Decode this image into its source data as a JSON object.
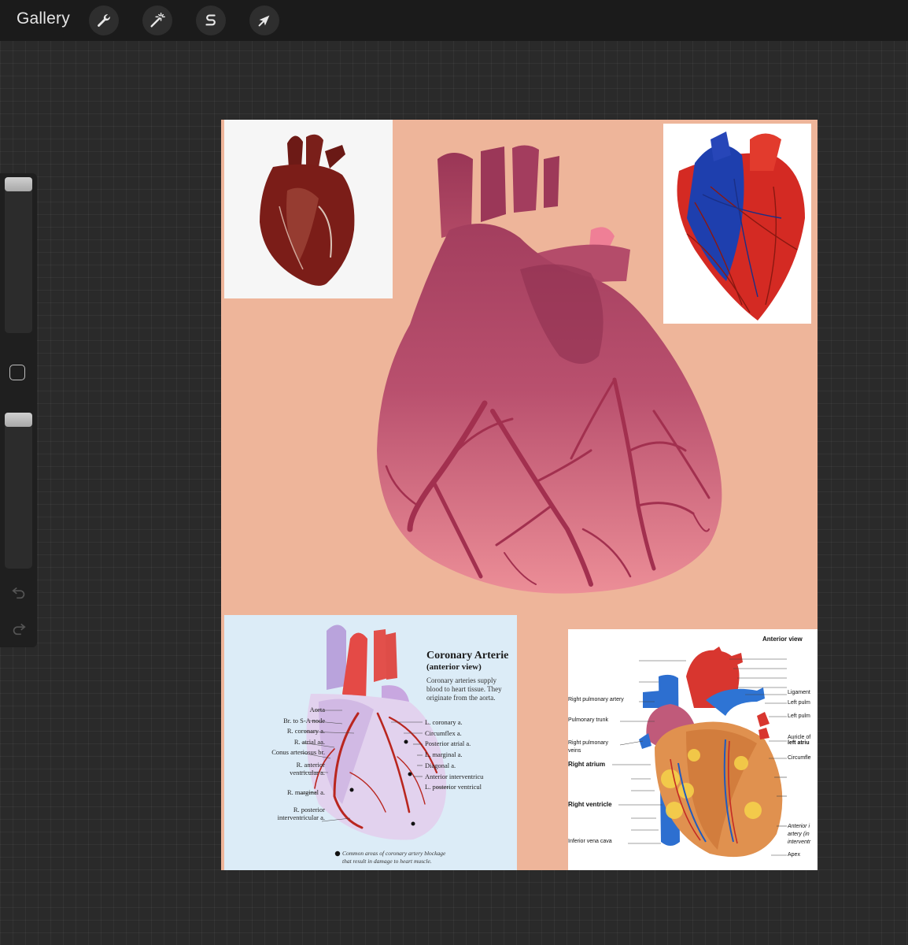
{
  "topbar": {
    "gallery_label": "Gallery",
    "tools": [
      {
        "name": "actions",
        "icon": "wrench-icon"
      },
      {
        "name": "adjustments",
        "icon": "magic-wand-icon"
      },
      {
        "name": "selection",
        "icon": "selection-s-icon"
      },
      {
        "name": "transform",
        "icon": "arrow-cursor-icon"
      }
    ]
  },
  "sidebar": {
    "brush_size_level": 0.0,
    "opacity_level": 0.0,
    "undo_icon": "undo-icon",
    "redo_icon": "redo-icon"
  },
  "colors": {
    "canvas_bg": "#eeb59a",
    "heart_main": "#b24a66",
    "vessel": "#a2304f"
  },
  "coronary_diagram": {
    "title": "Coronary Arterie",
    "subtitle": "(anterior view)",
    "description_lines": [
      "Coronary arteries supply",
      "blood to heart tissue. They",
      "originate from the aorta."
    ],
    "left_labels": [
      "Aorta",
      "Br. to S-A node",
      "R. coronary a.",
      "R. atrial aa.",
      "Conus arteriosus br.",
      "R. anterior",
      "ventricular a.",
      "R. marginal a.",
      "R. posterior",
      "interventricular a."
    ],
    "right_labels": [
      "L. coronary a.",
      "Circumflex a.",
      "Posterior atrial a.",
      "L. marginal a.",
      "Diagonal a.",
      "Anterior interventricu",
      "L. posterior ventricul"
    ],
    "footnote_lines": [
      "Common areas of coronary artery blockage",
      "that result in damage to heart muscle."
    ]
  },
  "anterior_diagram": {
    "title": "Anterior view",
    "left_labels": [
      "Right pulmonary artery",
      "Pulmonary trunk",
      "Right pulmonary",
      "veins",
      "Right atrium",
      "Right ventricle",
      "Inferior vena cava"
    ],
    "right_labels": [
      "Ligament",
      "Left pulm",
      "Left pulm",
      "Auricle of",
      "left atriu",
      "Circumfle",
      "Anterior i",
      "artery (in",
      "interventr",
      "Apex"
    ]
  }
}
